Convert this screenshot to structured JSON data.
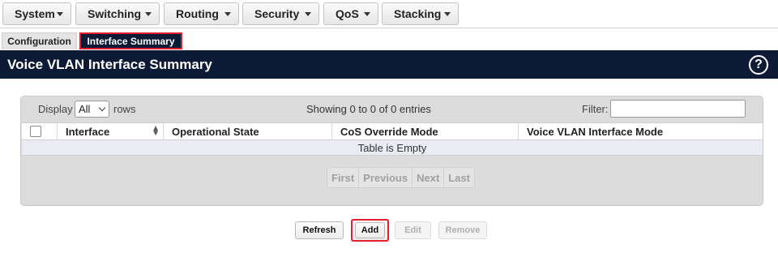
{
  "menu": {
    "items": [
      {
        "label": "System"
      },
      {
        "label": "Switching"
      },
      {
        "label": "Routing"
      },
      {
        "label": "Security"
      },
      {
        "label": "QoS"
      },
      {
        "label": "Stacking"
      }
    ]
  },
  "tabs": {
    "configuration": "Configuration",
    "interface_summary": "Interface Summary"
  },
  "page": {
    "title": "Voice VLAN Interface Summary",
    "help_glyph": "?"
  },
  "table_controls": {
    "display_label": "Display",
    "display_value": "All",
    "rows_label": "rows",
    "showing_text": "Showing 0 to 0 of 0 entries",
    "filter_label": "Filter:",
    "filter_value": ""
  },
  "table": {
    "columns": [
      "Interface",
      "Operational State",
      "CoS Override Mode",
      "Voice VLAN Interface Mode"
    ],
    "empty_text": "Table is Empty"
  },
  "pagination": {
    "first": "First",
    "previous": "Previous",
    "next": "Next",
    "last": "Last"
  },
  "actions": {
    "refresh": "Refresh",
    "add": "Add",
    "edit": "Edit",
    "remove": "Remove"
  },
  "colors": {
    "header_bg": "#0c1a36",
    "highlight_border": "#e0202a"
  }
}
